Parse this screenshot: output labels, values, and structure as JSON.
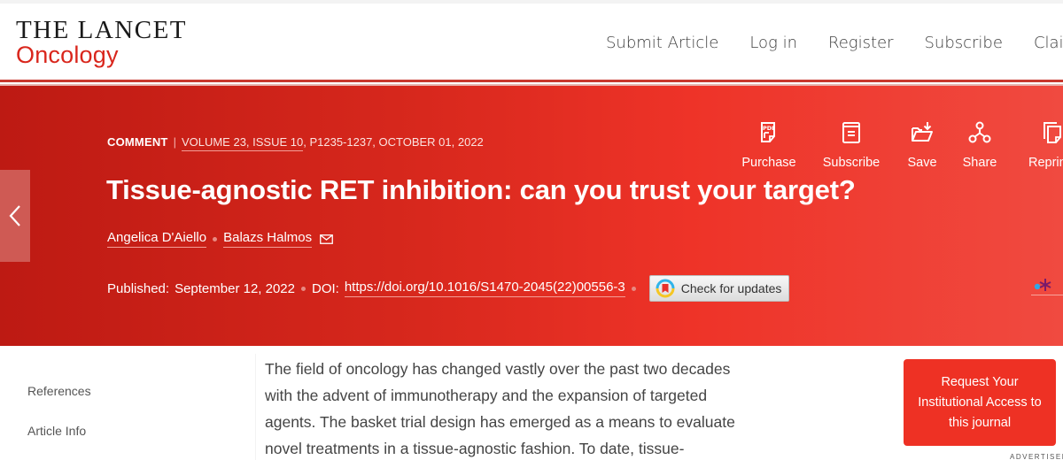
{
  "header": {
    "logo_top": "THE LANCET",
    "logo_bottom": "Oncology",
    "nav": [
      "Submit Article",
      "Log in",
      "Register",
      "Subscribe",
      "Claim"
    ]
  },
  "article": {
    "type": "COMMENT",
    "volume": "VOLUME 23, ISSUE 10",
    "pages_date": ", P1235-1237, OCTOBER 01, 2022",
    "title": "Tissue-agnostic RET inhibition: can you trust your target?",
    "authors": [
      "Angelica D'Aiello",
      "Balazs Halmos"
    ],
    "published_label": "Published:",
    "published_date": "September 12, 2022",
    "doi_label": "DOI:",
    "doi": "https://doi.org/10.1016/S1470-2045(22)00556-3",
    "check_updates": "Check for updates"
  },
  "actions": [
    {
      "label": "Purchase",
      "icon": "pdf-icon"
    },
    {
      "label": "Subscribe",
      "icon": "journal-icon"
    },
    {
      "label": "Save",
      "icon": "folder-download-icon"
    },
    {
      "label": "Share",
      "icon": "share-icon"
    },
    {
      "label": "Reprints",
      "icon": "reprints-icon"
    }
  ],
  "sidebar": {
    "items": [
      "References",
      "Article Info"
    ]
  },
  "body": {
    "paragraph": "The field of oncology has changed vastly over the past two decades with the advent of immunotherapy and the expansion of targeted agents. The basket trial design has emerged as a means to evaluate novel treatments in a tissue-agnostic fashion. To date, tissue-"
  },
  "access_button": "Request Your Institutional Access to this journal",
  "advertisement": "ADVERTISEMENT",
  "colors": {
    "brand_red": "#d9261c",
    "hero_start": "#bd1a13",
    "hero_end": "#f04a40",
    "access_button": "#ee3124"
  }
}
